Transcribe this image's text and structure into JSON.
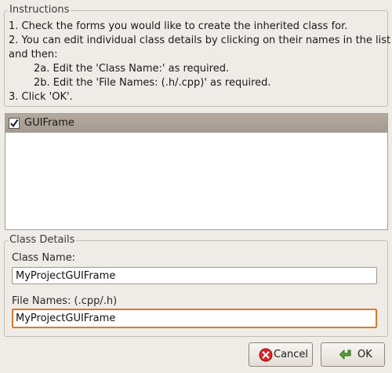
{
  "instructions": {
    "legend": "Instructions",
    "lines": [
      "1. Check the forms you would like to create the inherited class for.",
      "2. You can edit individual class details by clicking on their names in the list",
      "and then:",
      "2a. Edit the 'Class Name:' as required.",
      "2b. Edit the 'File Names: (.h/.cpp)' as required.",
      "3. Click 'OK'."
    ]
  },
  "form_list": {
    "items": [
      {
        "label": "GUIFrame",
        "checked": true
      }
    ]
  },
  "class_details": {
    "legend": "Class Details",
    "class_name_label": "Class Name:",
    "class_name_value": "MyProjectGUIFrame",
    "file_names_label": "File Names: (.cpp/.h)",
    "file_names_value": "MyProjectGUIFrame"
  },
  "buttons": {
    "cancel_label": "Cancel",
    "ok_label": "OK"
  },
  "colors": {
    "focus_border": "#d87a2a",
    "selected_row": "#a99f94",
    "cancel_icon": "#d8262b",
    "ok_icon": "#5aa33a"
  }
}
